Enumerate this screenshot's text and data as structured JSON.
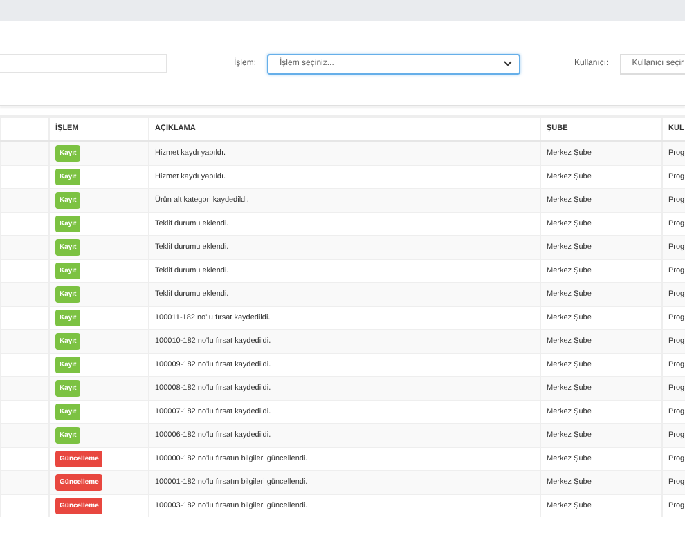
{
  "filters": {
    "operation": {
      "label": "İşlem:",
      "placeholder": "İşlem seçiniz...",
      "focused": true
    },
    "user": {
      "label": "Kullanıcı:",
      "placeholder": "Kullanıcı seçir"
    }
  },
  "table": {
    "columns": [
      "",
      "İŞLEM",
      "AÇIKLAMA",
      "ŞUBE",
      "KUL"
    ],
    "rows": [
      {
        "badge": "Kayıt",
        "kind": "create",
        "description": "Hizmet kaydı yapıldı.",
        "branch": "Merkez Şube",
        "user": "Prog"
      },
      {
        "badge": "Kayıt",
        "kind": "create",
        "description": "Hizmet kaydı yapıldı.",
        "branch": "Merkez Şube",
        "user": "Prog"
      },
      {
        "badge": "Kayıt",
        "kind": "create",
        "description": "Ürün alt kategori kaydedildi.",
        "branch": "Merkez Şube",
        "user": "Prog"
      },
      {
        "badge": "Kayıt",
        "kind": "create",
        "description": "Teklif durumu eklendi.",
        "branch": "Merkez Şube",
        "user": "Prog"
      },
      {
        "badge": "Kayıt",
        "kind": "create",
        "description": "Teklif durumu eklendi.",
        "branch": "Merkez Şube",
        "user": "Prog"
      },
      {
        "badge": "Kayıt",
        "kind": "create",
        "description": "Teklif durumu eklendi.",
        "branch": "Merkez Şube",
        "user": "Prog"
      },
      {
        "badge": "Kayıt",
        "kind": "create",
        "description": "Teklif durumu eklendi.",
        "branch": "Merkez Şube",
        "user": "Prog"
      },
      {
        "badge": "Kayıt",
        "kind": "create",
        "description": "100011-182 no'lu fırsat kaydedildi.",
        "branch": "Merkez Şube",
        "user": "Prog"
      },
      {
        "badge": "Kayıt",
        "kind": "create",
        "description": "100010-182 no'lu fırsat kaydedildi.",
        "branch": "Merkez Şube",
        "user": "Prog"
      },
      {
        "badge": "Kayıt",
        "kind": "create",
        "description": "100009-182 no'lu fırsat kaydedildi.",
        "branch": "Merkez Şube",
        "user": "Prog"
      },
      {
        "badge": "Kayıt",
        "kind": "create",
        "description": "100008-182 no'lu fırsat kaydedildi.",
        "branch": "Merkez Şube",
        "user": "Prog"
      },
      {
        "badge": "Kayıt",
        "kind": "create",
        "description": "100007-182 no'lu fırsat kaydedildi.",
        "branch": "Merkez Şube",
        "user": "Prog"
      },
      {
        "badge": "Kayıt",
        "kind": "create",
        "description": "100006-182 no'lu fırsat kaydedildi.",
        "branch": "Merkez Şube",
        "user": "Prog"
      },
      {
        "badge": "Güncelleme",
        "kind": "update",
        "description": "100000-182 no'lu fırsatın bilgileri güncellendi.",
        "branch": "Merkez Şube",
        "user": "Prog"
      },
      {
        "badge": "Güncelleme",
        "kind": "update",
        "description": "100001-182 no'lu fırsatın bilgileri güncellendi.",
        "branch": "Merkez Şube",
        "user": "Prog"
      },
      {
        "badge": "Güncelleme",
        "kind": "update",
        "description": "100003-182 no'lu fırsatın bilgileri güncellendi.",
        "branch": "Merkez Şube",
        "user": "Prog"
      }
    ]
  }
}
